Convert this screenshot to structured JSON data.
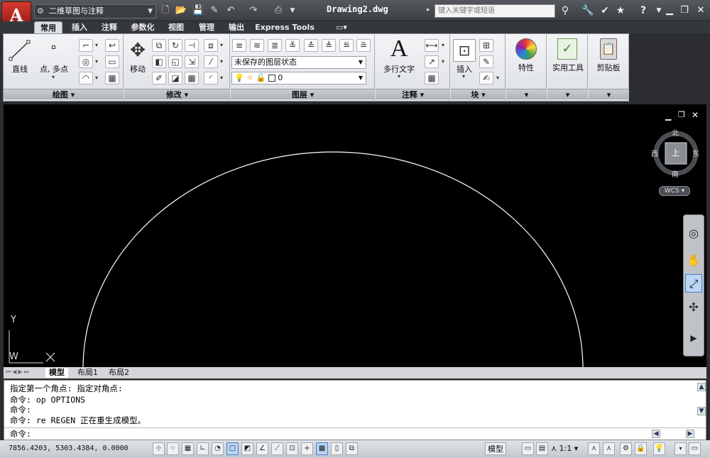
{
  "title_bar": {
    "app_logo": "A",
    "workspace": "二维草图与注释",
    "document": "Drawing2.dwg",
    "search_placeholder": "键入关键字或短语"
  },
  "ribbon_tabs": [
    "常用",
    "插入",
    "注释",
    "参数化",
    "视图",
    "管理",
    "输出",
    "Express Tools"
  ],
  "panels": {
    "draw": {
      "label": "绘图",
      "line": "直线",
      "point": "点, 多点"
    },
    "modify": {
      "label": "修改",
      "move": "移动"
    },
    "layers": {
      "label": "图层",
      "layer_state": "未保存的图层状态",
      "current_layer": "0"
    },
    "annotation": {
      "label": "注释",
      "mtext": "多行文字"
    },
    "block": {
      "label": "块",
      "insert": "插入"
    },
    "properties": {
      "label": "特性"
    },
    "utilities": {
      "label": "实用工具"
    },
    "clipboard": {
      "label": "剪贴板"
    }
  },
  "viewcube": {
    "north": "北",
    "south": "南",
    "east": "东",
    "west": "西",
    "face": "上",
    "wcs": "WCS"
  },
  "ucs": {
    "y": "Y",
    "w": "W"
  },
  "layout_tabs": [
    "模型",
    "布局1",
    "布局2"
  ],
  "command_history": [
    "指定第一个角点: 指定对角点:",
    "命令: op OPTIONS",
    "命令:",
    "命令: re REGEN 正在重生成模型。"
  ],
  "command_prompt": "命令:",
  "status": {
    "coordinates": "7856.4203, 5303.4384, 0.0000",
    "model_label": "模型",
    "scale": "1:1"
  },
  "colors": {
    "canvas": "#000000",
    "arc": "#ffffff",
    "app_red": "#c62a20"
  }
}
